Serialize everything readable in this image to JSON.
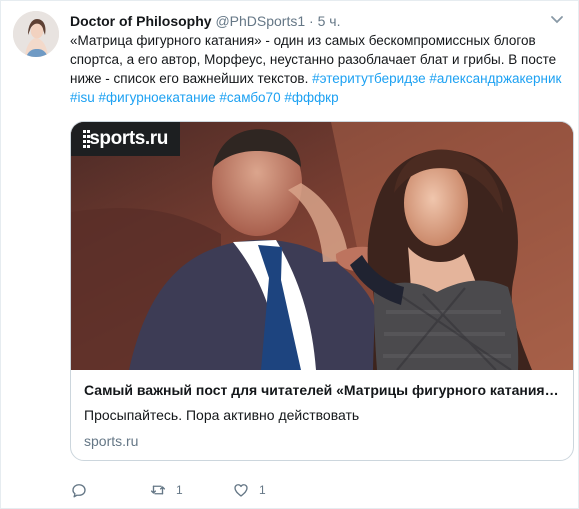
{
  "tweet": {
    "author": "Doctor of Philosophy",
    "handle": "@PhDSports1",
    "separator": "·",
    "time": "5 ч.",
    "text_parts": [
      {
        "text": "«Матрица фигурного катания» - один из самых бескомпромиссных блогов спортса, а его автор, Морфеус, неустанно разоблачает блат и грибы. В посте ниже - список его важнейших текстов. ",
        "type": "plain"
      },
      {
        "text": "#этеритутберидзе",
        "type": "hashtag"
      },
      {
        "text": " ",
        "type": "plain"
      },
      {
        "text": "#александржакерник",
        "type": "hashtag"
      },
      {
        "text": " ",
        "type": "plain"
      },
      {
        "text": "#isu",
        "type": "hashtag"
      },
      {
        "text": " ",
        "type": "plain"
      },
      {
        "text": "#фигурноекатание",
        "type": "hashtag"
      },
      {
        "text": " ",
        "type": "plain"
      },
      {
        "text": "#самбо70",
        "type": "hashtag"
      },
      {
        "text": " ",
        "type": "plain"
      },
      {
        "text": "#фффкр",
        "type": "hashtag"
      }
    ]
  },
  "card": {
    "logo": "sports.ru",
    "title": "Самый важный пост для читателей «Матрицы фигурного катания…",
    "description": "Просыпайтесь. Пора активно действовать",
    "domain": "sports.ru"
  },
  "actions": {
    "reply": {
      "icon": "reply-icon",
      "count": ""
    },
    "retweet": {
      "icon": "retweet-icon",
      "count": "1"
    },
    "like": {
      "icon": "heart-icon",
      "count": "1"
    }
  },
  "colors": {
    "accent": "#1da1f2",
    "muted": "#657786",
    "border": "#e6ecf0"
  }
}
